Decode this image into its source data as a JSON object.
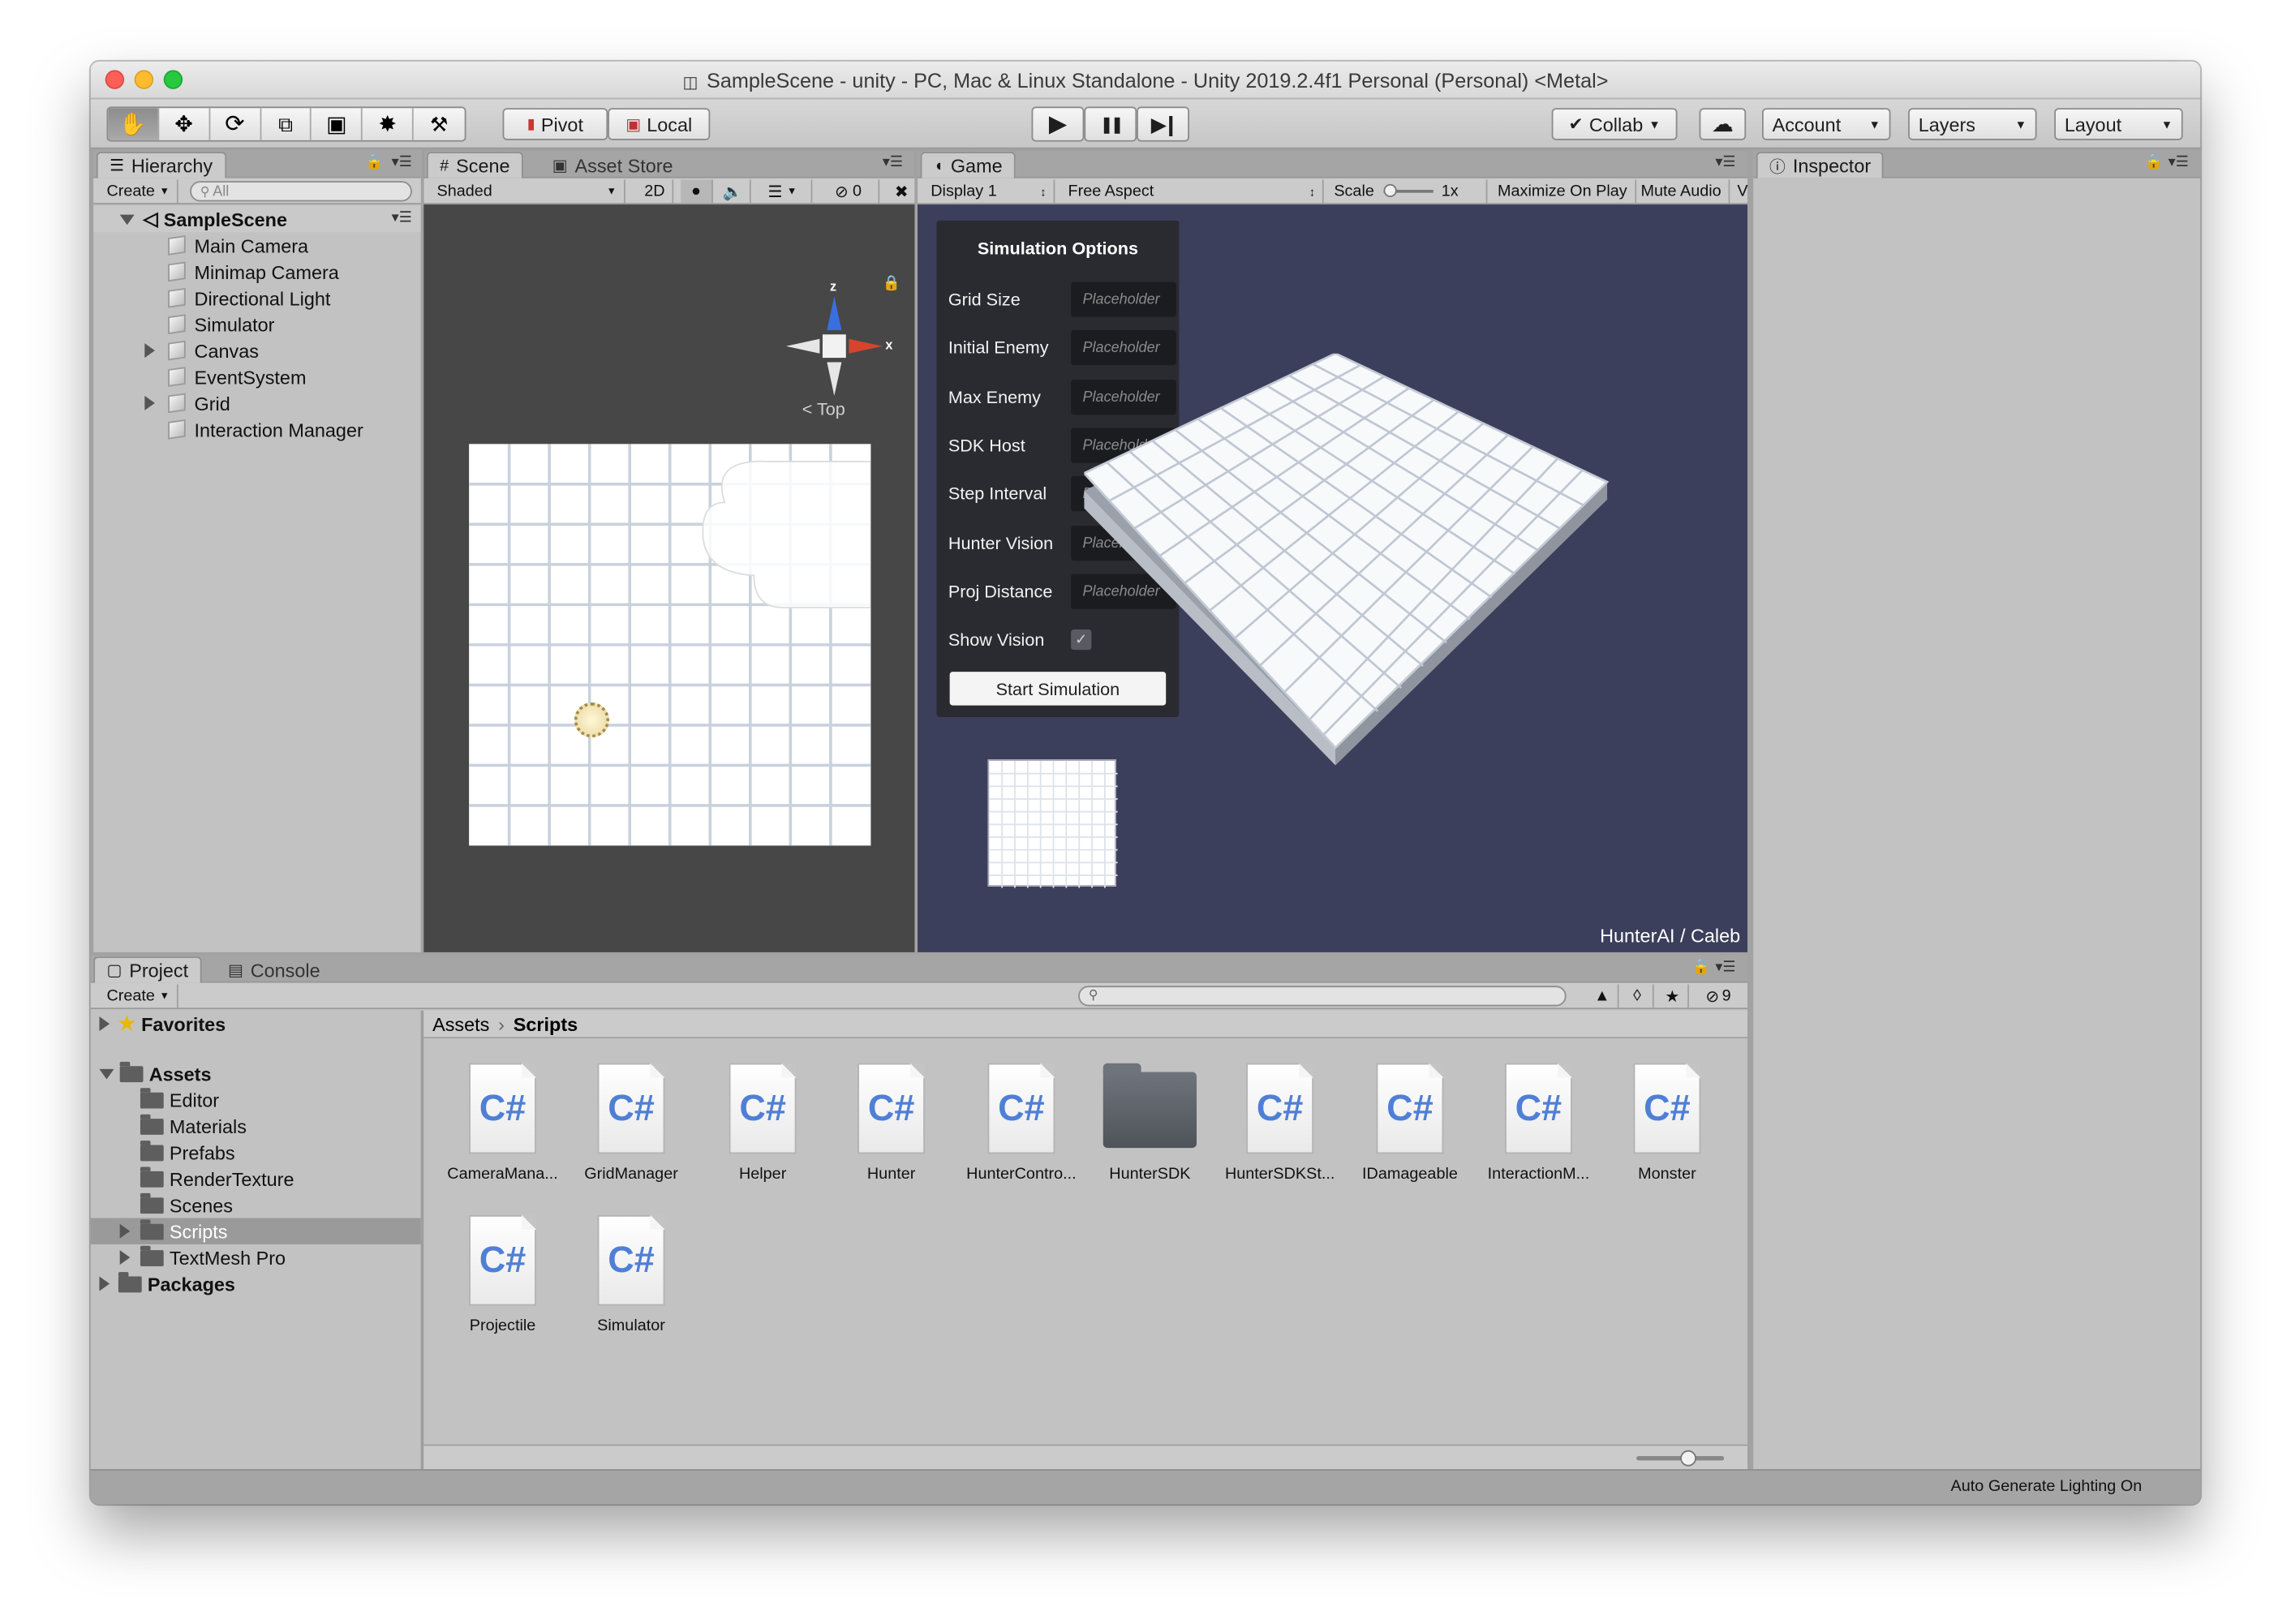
{
  "window": {
    "title": "SampleScene - unity - PC, Mac & Linux Standalone - Unity 2019.2.4f1 Personal (Personal) <Metal>"
  },
  "toolbar": {
    "pivot_label": "Pivot",
    "local_label": "Local",
    "collab_label": "Collab",
    "account_label": "Account",
    "layers_label": "Layers",
    "layout_label": "Layout",
    "play_icon": "▶",
    "pause_icon": "❚❚",
    "step_icon": "▶❙"
  },
  "hierarchy": {
    "tab_label": "Hierarchy",
    "create_label": "Create",
    "search_placeholder": "All",
    "scene_name": "SampleScene",
    "items": [
      "Main Camera",
      "Minimap Camera",
      "Directional Light",
      "Simulator",
      "Canvas",
      "EventSystem",
      "Grid",
      "Interaction Manager"
    ]
  },
  "scene_view": {
    "tab_scene": "Scene",
    "tab_asset_store": "Asset Store",
    "shading_mode": "Shaded",
    "mode_2d": "2D",
    "hidden_count": "0",
    "gizmo_z": "z",
    "gizmo_x": "x",
    "gizmo_view": "< Top"
  },
  "game_view": {
    "tab_label": "Game",
    "display": "Display 1",
    "aspect": "Free Aspect",
    "scale_label": "Scale",
    "scale_value": "1x",
    "maximize_label": "Maximize On Play",
    "mute_label": "Mute Audio",
    "overflow_label": "V",
    "credit": "HunterAI / Caleb",
    "sim_options": {
      "title": "Simulation Options",
      "fields": [
        {
          "label": "Grid Size",
          "placeholder": "Placeholder"
        },
        {
          "label": "Initial Enemy",
          "placeholder": "Placeholder"
        },
        {
          "label": "Max Enemy",
          "placeholder": "Placeholder"
        },
        {
          "label": "SDK Host",
          "placeholder": "Placeholder"
        },
        {
          "label": "Step Interval",
          "placeholder": "Placeholder"
        },
        {
          "label": "Hunter Vision",
          "placeholder": "Placeholder"
        },
        {
          "label": "Proj Distance",
          "placeholder": "Placeholder"
        }
      ],
      "show_vision_label": "Show Vision",
      "show_vision_checked": true,
      "start_button": "Start Simulation"
    }
  },
  "inspector": {
    "tab_label": "Inspector"
  },
  "project": {
    "tab_project": "Project",
    "tab_console": "Console",
    "create_label": "Create",
    "hidden_count": "9",
    "tree": {
      "favorites": "Favorites",
      "assets": "Assets",
      "children": [
        "Editor",
        "Materials",
        "Prefabs",
        "RenderTexture",
        "Scenes",
        "Scripts",
        "TextMesh Pro"
      ],
      "packages": "Packages"
    },
    "breadcrumb": {
      "root": "Assets",
      "current": "Scripts"
    },
    "files": [
      {
        "name": "CameraMana...",
        "type": "cs"
      },
      {
        "name": "GridManager",
        "type": "cs"
      },
      {
        "name": "Helper",
        "type": "cs"
      },
      {
        "name": "Hunter",
        "type": "cs"
      },
      {
        "name": "HunterContro...",
        "type": "cs"
      },
      {
        "name": "HunterSDK",
        "type": "folder"
      },
      {
        "name": "HunterSDKSt...",
        "type": "cs"
      },
      {
        "name": "IDamageable",
        "type": "cs"
      },
      {
        "name": "InteractionM...",
        "type": "cs"
      },
      {
        "name": "Monster",
        "type": "cs"
      },
      {
        "name": "Projectile",
        "type": "cs"
      },
      {
        "name": "Simulator",
        "type": "cs"
      }
    ],
    "cs_glyph": "C#"
  },
  "status_bar": {
    "text": "Auto Generate Lighting On"
  }
}
